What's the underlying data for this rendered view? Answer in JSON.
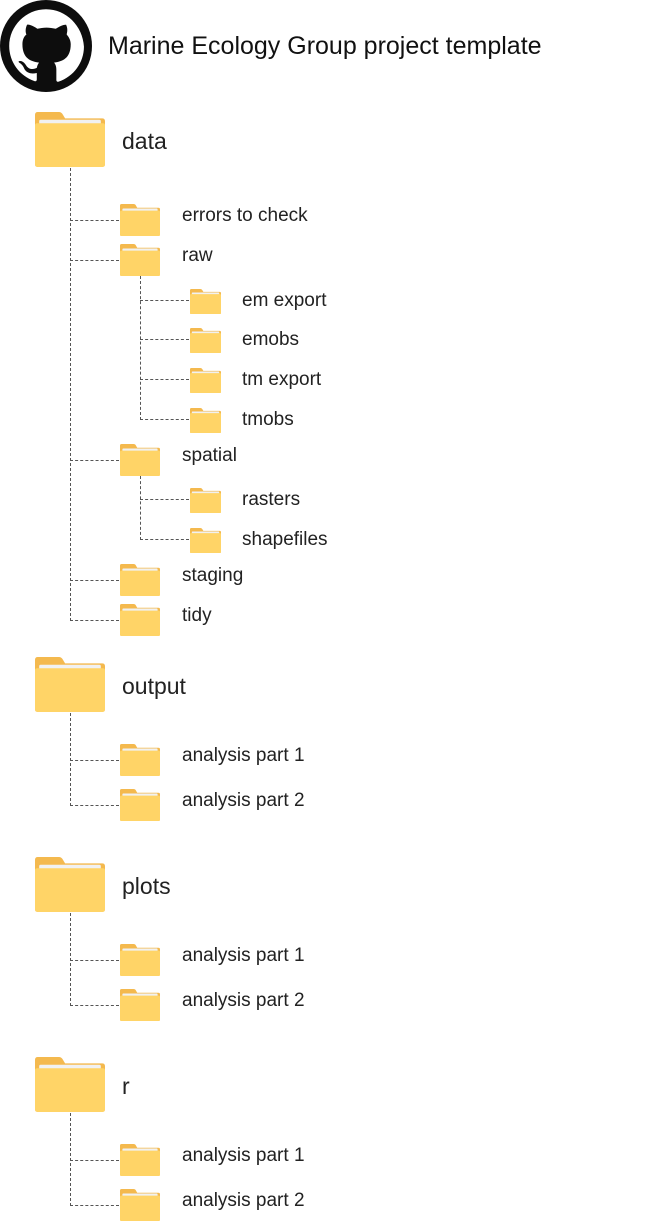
{
  "header": {
    "title": "Marine Ecology Group project template",
    "logo_icon": "github-octocat-icon"
  },
  "colors": {
    "folder_body": "#FFD467",
    "folder_back": "#F4B94E",
    "folder_paper": "#F1F1F1",
    "connector": "#555555"
  },
  "tree": [
    {
      "name": "data",
      "children": [
        {
          "name": "errors to check"
        },
        {
          "name": "raw",
          "children": [
            {
              "name": "em export"
            },
            {
              "name": "emobs"
            },
            {
              "name": "tm export"
            },
            {
              "name": "tmobs"
            }
          ]
        },
        {
          "name": "spatial",
          "children": [
            {
              "name": "rasters"
            },
            {
              "name": "shapefiles"
            }
          ]
        },
        {
          "name": "staging"
        },
        {
          "name": "tidy"
        }
      ]
    },
    {
      "name": "output",
      "children": [
        {
          "name": "analysis part 1"
        },
        {
          "name": "analysis part 2"
        }
      ]
    },
    {
      "name": "plots",
      "children": [
        {
          "name": "analysis part 1"
        },
        {
          "name": "analysis part 2"
        }
      ]
    },
    {
      "name": "r",
      "children": [
        {
          "name": "analysis part 1"
        },
        {
          "name": "analysis part 2"
        }
      ]
    }
  ]
}
